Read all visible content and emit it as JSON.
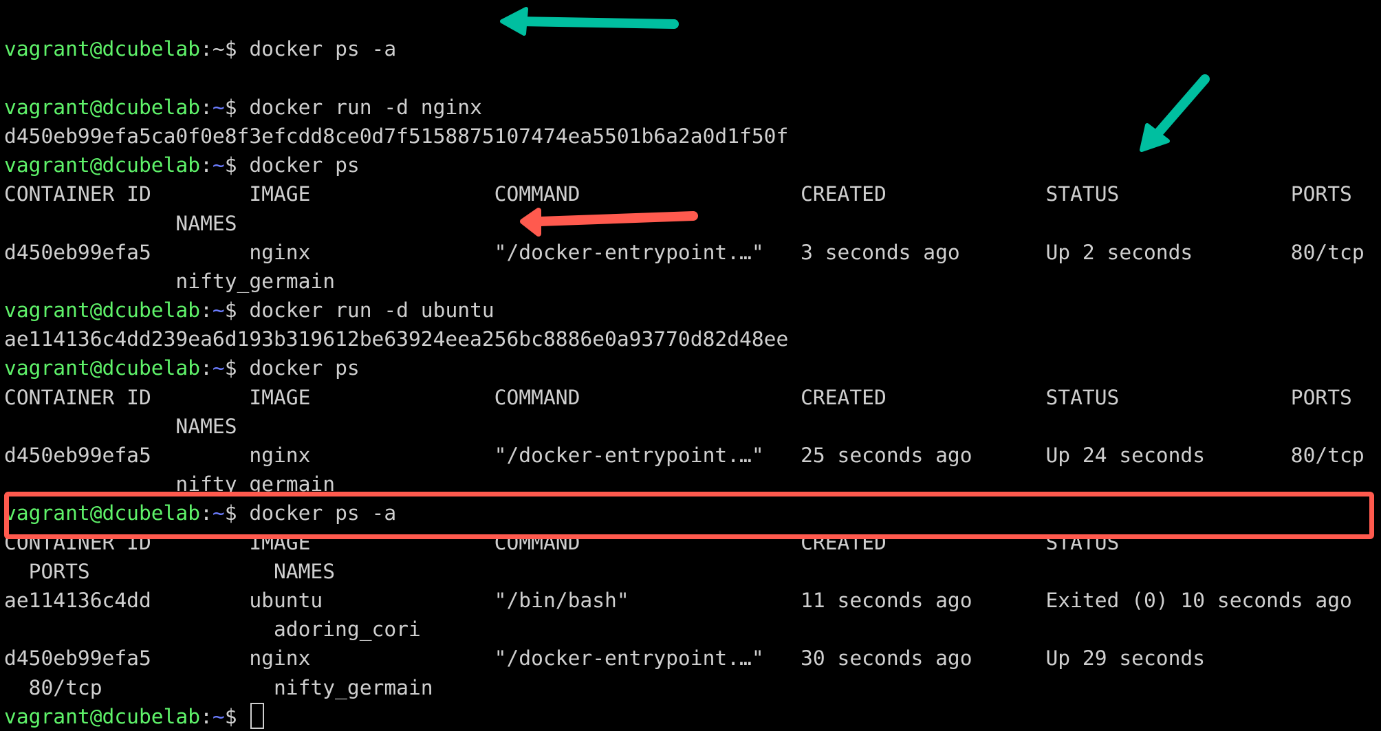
{
  "terminal": {
    "prompt": {
      "user_host": "vagrant@dcubelab",
      "colon": ":",
      "path": "~",
      "symbol": "$ "
    },
    "lines": [
      {
        "type": "prompt",
        "command": "docker run -d nginx"
      },
      {
        "type": "output",
        "text": "d450eb99efa5ca0f0e8f3efcdd8ce0d7f5158875107474ea5501b6a2a0d1f50f"
      },
      {
        "type": "prompt",
        "command": "docker ps"
      },
      {
        "type": "output",
        "text": "CONTAINER ID        IMAGE               COMMAND                  CREATED             STATUS              PORTS"
      },
      {
        "type": "output",
        "text": "              NAMES"
      },
      {
        "type": "output",
        "text": "d450eb99efa5        nginx               \"/docker-entrypoint.…\"   3 seconds ago       Up 2 seconds        80/tcp"
      },
      {
        "type": "output",
        "text": "              nifty_germain"
      },
      {
        "type": "prompt",
        "command": "docker run -d ubuntu"
      },
      {
        "type": "output",
        "text": "ae114136c4dd239ea6d193b319612be63924eea256bc8886e0a93770d82d48ee"
      },
      {
        "type": "prompt",
        "command": "docker ps"
      },
      {
        "type": "output",
        "text": "CONTAINER ID        IMAGE               COMMAND                  CREATED             STATUS              PORTS"
      },
      {
        "type": "output",
        "text": "              NAMES"
      },
      {
        "type": "output",
        "text": "d450eb99efa5        nginx               \"/docker-entrypoint.…\"   25 seconds ago      Up 24 seconds       80/tcp"
      },
      {
        "type": "output",
        "text": "              nifty_germain"
      },
      {
        "type": "prompt",
        "command": "docker ps -a"
      },
      {
        "type": "output",
        "text": "CONTAINER ID        IMAGE               COMMAND                  CREATED             STATUS"
      },
      {
        "type": "output",
        "text": "  PORTS               NAMES"
      },
      {
        "type": "output",
        "text": "ae114136c4dd        ubuntu              \"/bin/bash\"              11 seconds ago      Exited (0) 10 seconds ago"
      },
      {
        "type": "output",
        "text": "                      adoring_cori"
      },
      {
        "type": "output",
        "text": "d450eb99efa5        nginx               \"/docker-entrypoint.…\"   30 seconds ago      Up 29 seconds"
      },
      {
        "type": "output",
        "text": "  80/tcp              nifty_germain"
      },
      {
        "type": "prompt",
        "command": "",
        "cursor": true
      }
    ]
  },
  "annotations": {
    "teal_color": "#00bfa0",
    "red_color": "#ff5a4e",
    "arrows": [
      {
        "name": "arrow-docker-run-nginx",
        "color": "teal",
        "points_to": "docker run -d nginx"
      },
      {
        "name": "arrow-up-2-seconds",
        "color": "teal",
        "points_to": "Up 2 seconds"
      },
      {
        "name": "arrow-docker-run-ubuntu",
        "color": "red",
        "points_to": "docker run -d ubuntu"
      }
    ],
    "highlight_box": {
      "color": "red",
      "highlights": "ae114136c4dd ubuntu exited container row"
    }
  }
}
